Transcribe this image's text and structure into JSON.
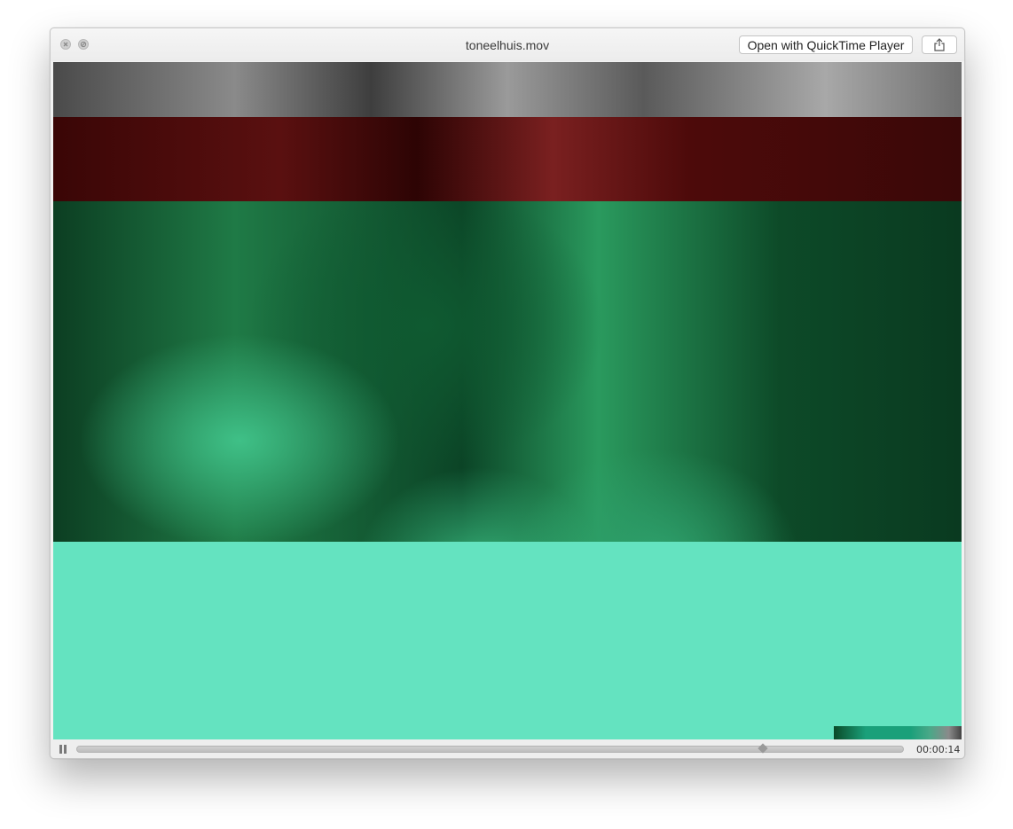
{
  "window": {
    "title": "toneelhuis.mov",
    "open_with_label": "Open with QuickTime Player",
    "share_icon": "share-icon",
    "close_icon": "close-icon",
    "minimize_icon": "minimize-icon"
  },
  "video": {
    "content": "corrupted-frame-glitch",
    "colors": {
      "grayscale_top": "#6e6e6e",
      "dark_red_band": "#4a0b0b",
      "green_band": "#1f8a4e",
      "mint_band": "#64e3c0"
    }
  },
  "controls": {
    "pause_icon": "pause-icon",
    "elapsed_time": "00:00:14",
    "progress_fraction": 0.83
  }
}
